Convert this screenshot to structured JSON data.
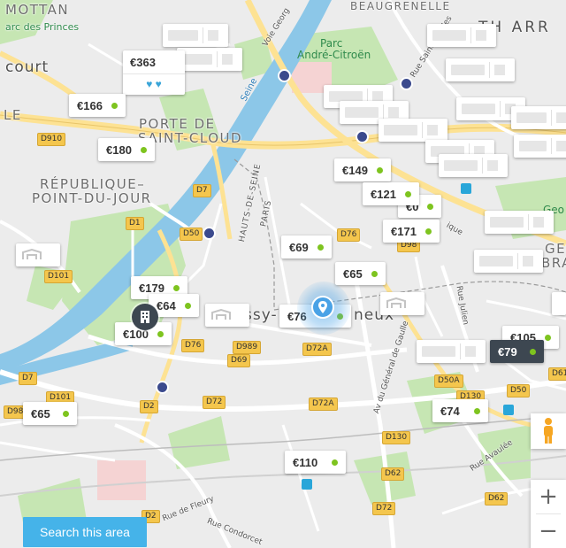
{
  "map": {
    "place_labels": [
      "MOTTAN",
      "arc des Princes",
      "court",
      "LE",
      "PORTE DE",
      "SAINT-CLOUD",
      "RÉPUBLIQUE–",
      "POINT-DU-JOUR",
      "TH ARR",
      "BEAUGRENELLE",
      "GE",
      "BRA",
      "Issy-",
      "neux"
    ],
    "street_labels": [
      "Seine",
      "Voie Georg",
      "Rue Saint-Charles",
      "HAUTS-DE-SEINE",
      "PARIS",
      "Rue Julien",
      "Av du Général de Gaulle",
      "Rue Avaulée",
      "Rue de Fleury",
      "Rue Condorcet",
      "ique"
    ],
    "green_labels": [
      "Parc",
      "André-Citroën",
      "Geo"
    ],
    "road_labels": [
      "D910",
      "D7",
      "D1",
      "D50",
      "D76",
      "D98",
      "D101",
      "D989",
      "D69",
      "D72A",
      "D72",
      "D2",
      "D72A",
      "D130",
      "D50A",
      "D130",
      "D50",
      "D61",
      "D62",
      "D62",
      "D72",
      "D2",
      "D7",
      "D989",
      "D101",
      "D76"
    ]
  },
  "listings": [
    {
      "price": "€363",
      "dot": "orange",
      "expanded": true,
      "rating": "♥ ♥"
    },
    {
      "price": "€166"
    },
    {
      "price": "€180"
    },
    {
      "price": "€149"
    },
    {
      "price": "€121"
    },
    {
      "price": "€0"
    },
    {
      "price": "€171"
    },
    {
      "price": "€69"
    },
    {
      "price": "€65"
    },
    {
      "price": "€179"
    },
    {
      "price": "€64"
    },
    {
      "price": "€100"
    },
    {
      "price": "€76"
    },
    {
      "price": "€105"
    },
    {
      "price": "€79",
      "selected": true
    },
    {
      "price": "€74"
    },
    {
      "price": "€65"
    },
    {
      "price": "€110"
    }
  ],
  "controls": {
    "search_button_label": "Search this area",
    "zoom_in": "+",
    "zoom_out": "−"
  },
  "colors": {
    "water": "#8cc7e8",
    "park": "#c6e6b3",
    "road_major": "#fde293",
    "accent_blue": "#45b3e9",
    "pin_dot_green": "#7ec41f",
    "pin_dot_orange": "#f7941d",
    "pin_selected": "#3d4751"
  }
}
